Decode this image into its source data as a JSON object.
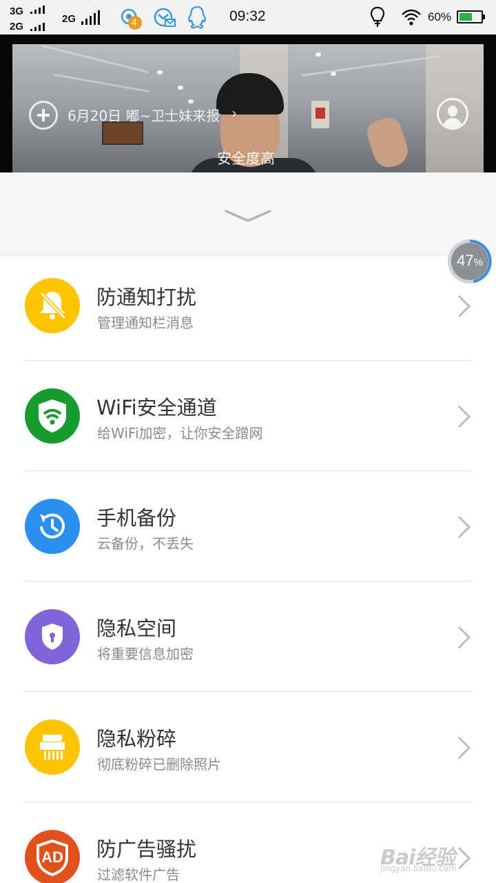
{
  "status_bar": {
    "sim1_network": "3G",
    "sim2_network": "2G",
    "sim2_network_b": "2G",
    "notification_badge": "4",
    "time": "09:32",
    "battery_text": "60%",
    "battery_level": 0.6,
    "icons": [
      "weather-badge-icon",
      "mail-icon",
      "qq-icon",
      "lightbulb-icon",
      "wifi-icon",
      "battery-icon"
    ]
  },
  "header": {
    "news_text": "6月20日 嘟~卫士妹来报",
    "news_chevron": "›",
    "security_status": "安全度高"
  },
  "progress": {
    "value": "47",
    "unit": "%",
    "fraction": 0.47,
    "color": "#3b8ee8"
  },
  "items": [
    {
      "title": "防通知打扰",
      "subtitle": "管理通知栏消息",
      "icon": "bell-off-icon",
      "color": "#fdc400"
    },
    {
      "title": "WiFi安全通道",
      "subtitle": "给WiFi加密，让你安全蹭网",
      "icon": "wifi-shield-icon",
      "color": "#169b2f"
    },
    {
      "title": "手机备份",
      "subtitle": "云备份，不丢失",
      "icon": "history-icon",
      "color": "#2b8ff0"
    },
    {
      "title": "隐私空间",
      "subtitle": "将重要信息加密",
      "icon": "lock-shield-icon",
      "color": "#8165d8"
    },
    {
      "title": "隐私粉碎",
      "subtitle": "彻底粉碎已删除照片",
      "icon": "shredder-icon",
      "color": "#fdc400"
    },
    {
      "title": "防广告骚扰",
      "subtitle": "过滤软件广告",
      "icon": "ad-shield-icon",
      "color": "#e2501b",
      "ad_label": "AD"
    }
  ],
  "watermark": {
    "brand": "Bai经验",
    "url": "jingyan.baidu.com"
  }
}
